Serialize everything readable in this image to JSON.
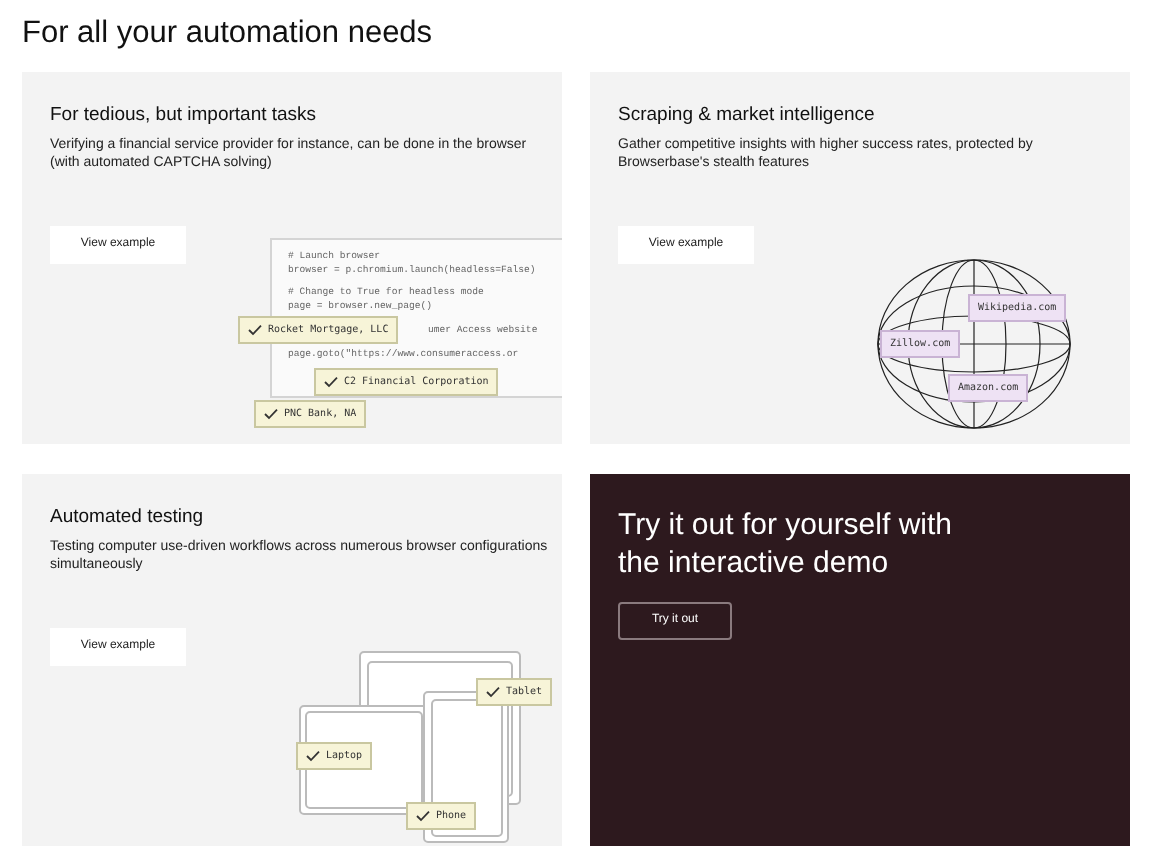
{
  "heading": "For all your automation needs",
  "cards": [
    {
      "kind": "code",
      "title": "For tedious, but important tasks",
      "description": "Verifying a financial service provider for instance, can be done in the browser (with automated CAPTCHA solving)",
      "button": "View example",
      "code_lines": [
        "# Launch browser",
        "browser = p.chromium.launch(headless=False)",
        "# Change to True for headless mode",
        "page = browser.new_page()",
        "umer Access website",
        "page.goto(\"https://www.consumeraccess.or"
      ],
      "tags": [
        "Rocket Mortgage, LLC",
        "C2 Financial Corporation",
        "PNC Bank, NA"
      ]
    },
    {
      "kind": "globe",
      "title": "Scraping & market intelligence",
      "description": "Gather competitive insights with higher success rates, protected by Browserbase's stealth features",
      "button": "View example",
      "tags": [
        "Wikipedia.com",
        "Zillow.com",
        "Amazon.com"
      ]
    },
    {
      "kind": "devices",
      "title": "Automated testing",
      "description": "Testing computer use-driven workflows across numerous browser configurations simultaneously",
      "button": "View example",
      "tags": [
        "Tablet",
        "Laptop",
        "Phone"
      ]
    },
    {
      "kind": "demo",
      "title": "Try it out for yourself with the interactive demo",
      "button": "Try it out"
    }
  ]
}
